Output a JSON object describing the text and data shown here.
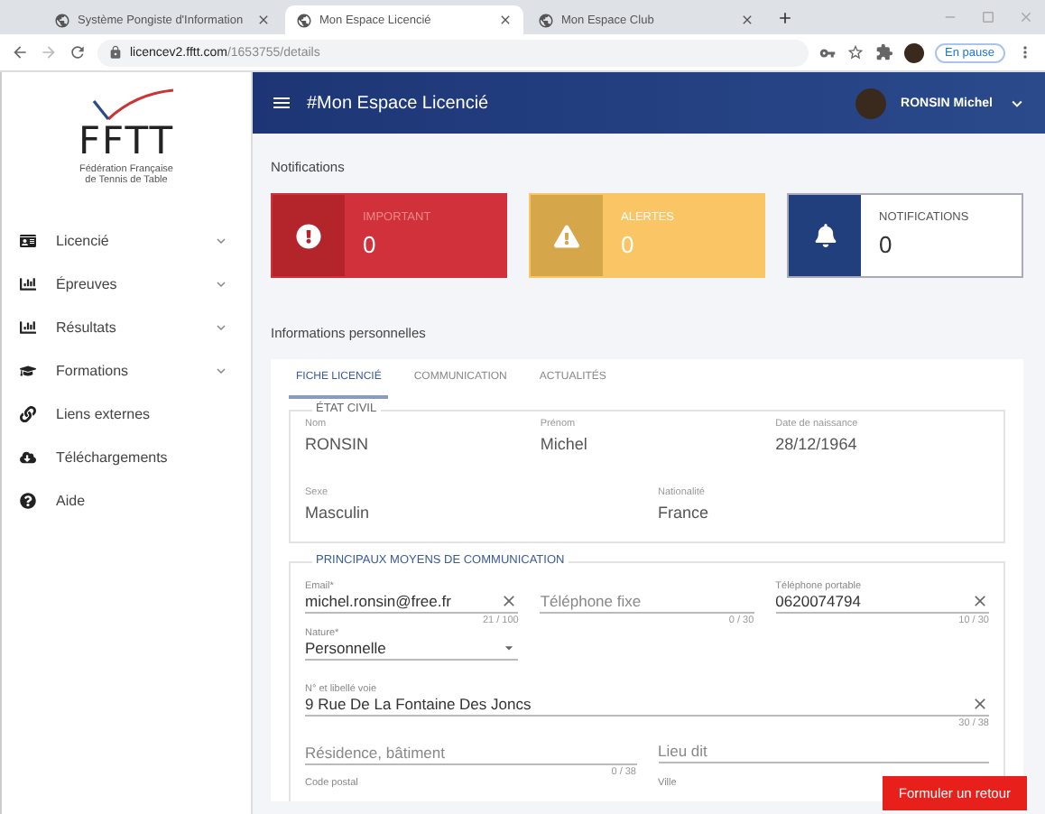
{
  "browser": {
    "tabs": [
      {
        "title": "Système Pongiste d'Information",
        "selected": false
      },
      {
        "title": "Mon Espace Licencié",
        "selected": true
      },
      {
        "title": "Mon Espace Club",
        "selected": false
      }
    ],
    "url_host": "licencev2.fftt.com",
    "url_path": "/1653755/details",
    "profile_status": "En pause"
  },
  "sidebar": {
    "logo_text": "FFTT",
    "org_lines": [
      "Fédération Française",
      "de Tennis de Table"
    ],
    "items": [
      {
        "label": "Licencié",
        "expandable": true
      },
      {
        "label": "Épreuves",
        "expandable": true
      },
      {
        "label": "Résultats",
        "expandable": true
      },
      {
        "label": "Formations",
        "expandable": true
      },
      {
        "label": "Liens externes",
        "expandable": false
      },
      {
        "label": "Téléchargements",
        "expandable": false
      },
      {
        "label": "Aide",
        "expandable": false
      }
    ]
  },
  "header": {
    "title": "#Mon Espace Licencié",
    "user_name": "RONSIN Michel"
  },
  "notifications": {
    "title": "Notifications",
    "cards": [
      {
        "kind": "important",
        "label": "IMPORTANT",
        "count": "0"
      },
      {
        "kind": "alert",
        "label": "ALERTES",
        "count": "0"
      },
      {
        "kind": "info",
        "label": "NOTIFICATIONS",
        "count": "0"
      }
    ]
  },
  "personal": {
    "title": "Informations personnelles",
    "tabs": [
      {
        "label": "FICHE LICENCIÉ",
        "selected": true
      },
      {
        "label": "COMMUNICATION",
        "selected": false
      },
      {
        "label": "ACTUALITÉS",
        "selected": false
      }
    ],
    "etat_civil": {
      "legend": "ÉTAT CIVIL",
      "rows": [
        [
          {
            "label": "Nom",
            "value": "RONSIN"
          },
          {
            "label": "Prénom",
            "value": "Michel"
          },
          {
            "label": "Date de naissance",
            "value": "28/12/1964"
          }
        ],
        [
          {
            "label": "Sexe",
            "value": "Masculin"
          },
          {
            "label": "Nationalité",
            "value": "France"
          }
        ]
      ]
    },
    "communication": {
      "legend": "PRINCIPAUX MOYENS DE COMMUNICATION",
      "rows": [
        [
          {
            "kind": "text",
            "label": "Email*",
            "value": "michel.ronsin@free.fr",
            "clearable": true,
            "counter": "21 / 100"
          },
          {
            "kind": "text",
            "placeholder": "Téléphone fixe",
            "clearable": false,
            "counter": "0 / 30"
          },
          {
            "kind": "text",
            "label": "Téléphone portable",
            "value": "0620074794",
            "clearable": true,
            "counter": "10 / 30"
          }
        ],
        [
          {
            "kind": "select",
            "label": "Nature*",
            "value": "Personnelle"
          },
          {
            "kind": "spacer"
          },
          {
            "kind": "spacer"
          }
        ],
        [
          {
            "kind": "text",
            "label": "N° et libellé voie",
            "value": "9 Rue De La Fontaine Des Joncs",
            "clearable": true,
            "counter": "30 / 38"
          }
        ],
        [
          {
            "kind": "text",
            "placeholder": "Résidence, bâtiment",
            "clearable": false,
            "counter": "0 / 38"
          },
          {
            "kind": "text",
            "placeholder": "Lieu dit",
            "clearable": false
          }
        ],
        [
          {
            "kind": "label",
            "label": "Code postal"
          },
          {
            "kind": "label",
            "label": "Ville"
          }
        ]
      ]
    }
  },
  "feedback_button": "Formuler un retour"
}
